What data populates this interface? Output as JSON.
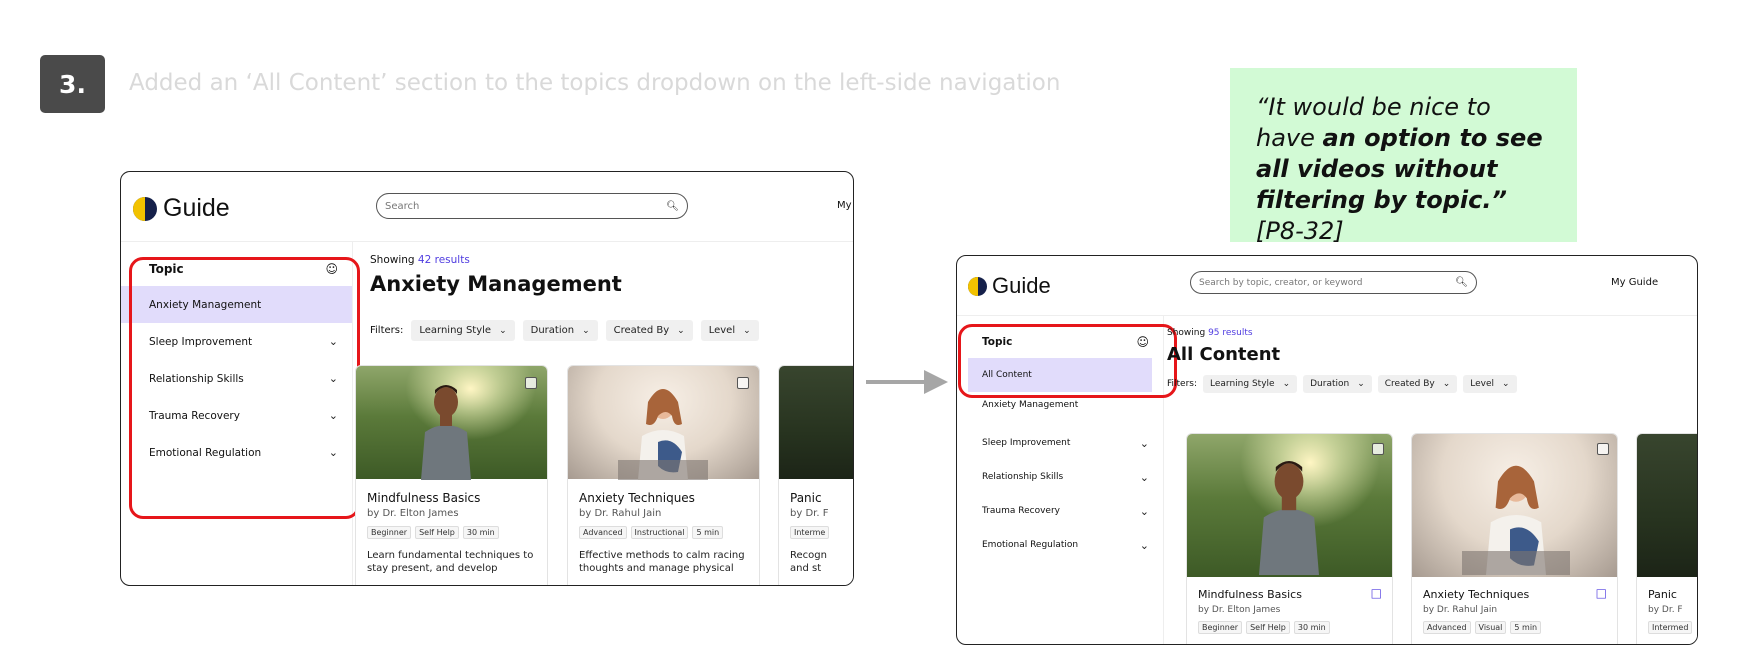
{
  "step": {
    "number": "3.",
    "headline": "Added an ‘All Content’ section to the topics dropdown on the left-side navigation"
  },
  "quote": {
    "open": "“It would be nice to have ",
    "bold": "an option to see all videos without filtering by topic.”",
    "ref": " [P8-32]"
  },
  "colors": {
    "accent": "#4f3ce0",
    "highlight": "#e1dcfb",
    "callout": "#e6161a",
    "quote_bg": "#d2fad5"
  },
  "before": {
    "app_name": "Guide",
    "search_placeholder": "Search",
    "nav_link": "My",
    "topic_header": "Topic",
    "topics": [
      {
        "label": "Anxiety Management",
        "active": true
      },
      {
        "label": "Sleep Improvement"
      },
      {
        "label": "Relationship Skills"
      },
      {
        "label": "Trauma Recovery"
      },
      {
        "label": "Emotional Regulation"
      }
    ],
    "showing_label": "Showing",
    "result_count": "42 results",
    "page_title": "Anxiety Management",
    "filters_label": "Filters:",
    "filters": [
      "Learning Style",
      "Duration",
      "Created By",
      "Level"
    ],
    "cards": [
      {
        "title": "Mindfulness Basics",
        "author": "by Dr. Elton James",
        "tags": [
          "Beginner",
          "Self Help",
          "30 min"
        ],
        "desc": "Learn fundamental techniques to stay present, and develop"
      },
      {
        "title": "Anxiety Techniques",
        "author": "by Dr. Rahul Jain",
        "tags": [
          "Advanced",
          "Instructional",
          "5 min"
        ],
        "desc": "Effective methods to calm racing thoughts and manage physical"
      },
      {
        "title": "Panic",
        "author": "by Dr. F",
        "tags": [
          "Interme"
        ],
        "desc": "Recogn and st"
      }
    ]
  },
  "after": {
    "app_name": "Guide",
    "search_placeholder": "Search by topic, creator, or keyword",
    "nav_link": "My Guide",
    "topic_header": "Topic",
    "topics": [
      {
        "label": "All Content",
        "active": true
      },
      {
        "label": "Anxiety Management"
      },
      {
        "label": "Sleep Improvement"
      },
      {
        "label": "Relationship Skills"
      },
      {
        "label": "Trauma Recovery"
      },
      {
        "label": "Emotional Regulation"
      }
    ],
    "showing_label": "Showing",
    "result_count": "95 results",
    "page_title": "All Content",
    "filters_label": "Filters:",
    "filters": [
      "Learning Style",
      "Duration",
      "Created By",
      "Level"
    ],
    "cards": [
      {
        "title": "Mindfulness Basics",
        "author": "by Dr. Elton James",
        "tags": [
          "Beginner",
          "Self Help",
          "30 min"
        ]
      },
      {
        "title": "Anxiety Techniques",
        "author": "by Dr. Rahul Jain",
        "tags": [
          "Advanced",
          "Visual",
          "5 min"
        ]
      },
      {
        "title": "Panic",
        "author": "by Dr. F",
        "tags": [
          "Intermed"
        ]
      }
    ]
  }
}
